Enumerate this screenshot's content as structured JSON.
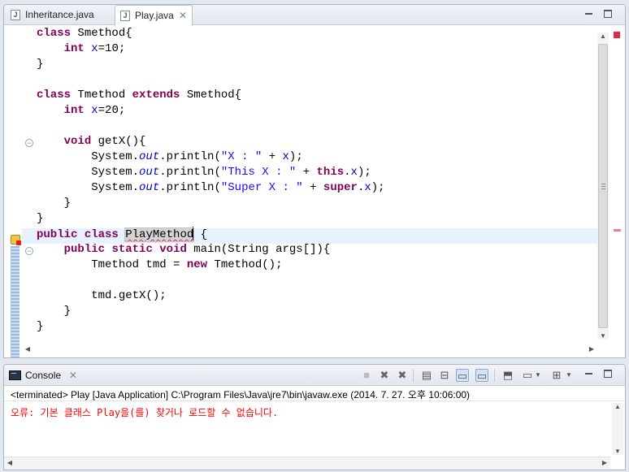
{
  "editor": {
    "tabs": [
      {
        "label": "Inheritance.java",
        "icon": "java-file-icon",
        "active": false
      },
      {
        "label": "Play.java",
        "icon": "java-file-icon",
        "active": true
      }
    ],
    "lines": [
      "class Smethod{",
      "    int x=10;",
      "}",
      "",
      "class Tmethod extends Smethod{",
      "    int x=20;",
      "",
      "    void getX(){",
      "        System.out.println(\"X : \" + x);",
      "        System.out.println(\"This X : \" + this.x);",
      "        System.out.println(\"Super X : \" + super.x);",
      "    }",
      "}",
      "public class PlayMethod {",
      "    public static void main(String args[]){",
      "        Tmethod tmd = new Tmethod();",
      "",
      "        tmd.getX();",
      "    }",
      "}"
    ],
    "highlighted_identifier": "PlayMethod",
    "current_line": 14
  },
  "console": {
    "tab_label": "Console",
    "process_info": "<terminated> Play [Java Application] C:\\Program Files\\Java\\jre7\\bin\\javaw.exe (2014. 7. 27. 오후 10:06:00)",
    "output": "오류: 기본 클래스 Play을(를) 찾거나 로드할 수 없습니다.",
    "output_color": "#ff0000"
  },
  "colors": {
    "keyword": "#7f0055",
    "string": "#2a00ff",
    "field": "#0000c0"
  }
}
